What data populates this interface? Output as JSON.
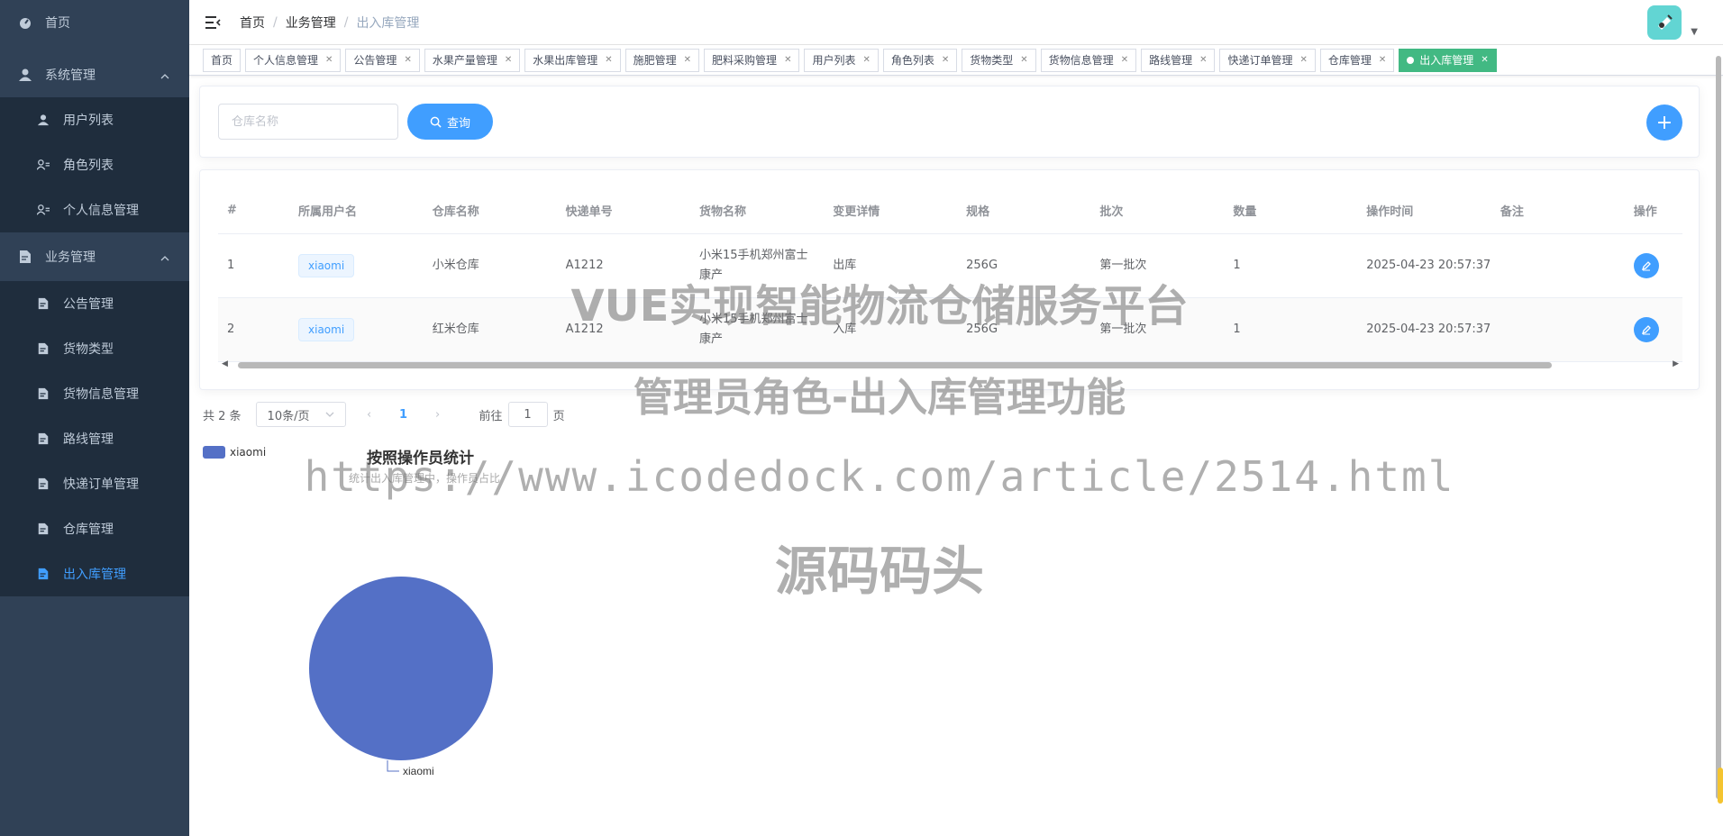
{
  "sidebar": {
    "home": "首页",
    "system": "系统管理",
    "system_items": [
      "用户列表",
      "角色列表",
      "个人信息管理"
    ],
    "business": "业务管理",
    "business_items": [
      "公告管理",
      "货物类型",
      "货物信息管理",
      "路线管理",
      "快递订单管理",
      "仓库管理",
      "出入库管理"
    ]
  },
  "breadcrumb": [
    "首页",
    "业务管理",
    "出入库管理"
  ],
  "tags": [
    "首页",
    "个人信息管理",
    "公告管理",
    "水果产量管理",
    "水果出库管理",
    "施肥管理",
    "肥料采购管理",
    "用户列表",
    "角色列表",
    "货物类型",
    "货物信息管理",
    "路线管理",
    "快递订单管理",
    "仓库管理",
    "出入库管理"
  ],
  "search": {
    "placeholder": "仓库名称",
    "button": "查询"
  },
  "table": {
    "headers": [
      "#",
      "所属用户名",
      "仓库名称",
      "快递单号",
      "货物名称",
      "变更详情",
      "规格",
      "批次",
      "数量",
      "操作时间",
      "备注",
      "操作"
    ],
    "rows": [
      {
        "idx": "1",
        "user": "xiaomi",
        "warehouse": "小米仓库",
        "tracking": "A1212",
        "goods": "小米15手机郑州富士康产",
        "change": "出库",
        "spec": "256G",
        "batch": "第一批次",
        "qty": "1",
        "time": "2025-04-23 20:57:37",
        "note": ""
      },
      {
        "idx": "2",
        "user": "xiaomi",
        "warehouse": "红米仓库",
        "tracking": "A1212",
        "goods": "小米15手机郑州富士康产",
        "change": "入库",
        "spec": "256G",
        "batch": "第一批次",
        "qty": "1",
        "time": "2025-04-23 20:57:37",
        "note": ""
      }
    ]
  },
  "pagination": {
    "total": "共 2 条",
    "page_size": "10条/页",
    "current": "1",
    "goto_prefix": "前往",
    "goto_value": "1",
    "goto_suffix": "页"
  },
  "chart_data": {
    "type": "pie",
    "title": "按照操作员统计",
    "subtitle": "统计出入库管理中，操作员占比",
    "legend": [
      "xiaomi"
    ],
    "slices": [
      {
        "name": "xiaomi",
        "value": 2,
        "color": "#5470c6"
      }
    ]
  },
  "watermark": {
    "line1": "VUE实现智能物流仓储服务平台",
    "line2": "管理员角色-出入库管理功能",
    "line3": "https://www.icodedock.com/article/2514.html",
    "line4": "源码码头"
  },
  "colors": {
    "sidebar_bg": "#304156",
    "primary": "#409eff",
    "active_tag": "#42b983"
  }
}
